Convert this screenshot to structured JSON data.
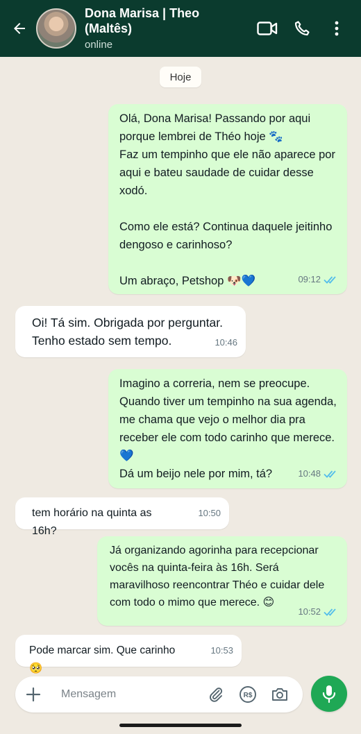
{
  "header": {
    "contact_name": "Dona Marisa | Theo (Maltês)",
    "status": "online",
    "background": "#0b3b2e"
  },
  "chat": {
    "date_chip": "Hoje",
    "messages": [
      {
        "direction": "out",
        "text": "Olá, Dona Marisa! Passando por aqui porque lembrei de Théo hoje 🐾\nFaz um tempinho que ele não aparece por aqui e bateu saudade de cuidar desse xodó.\n\nComo ele está? Continua daquele jeitinho dengoso e carinhoso?\n\nUm abraço, Petshop 🐶💙",
        "time": "09:12",
        "read": true
      },
      {
        "direction": "in",
        "text": "Oi! Tá sim. Obrigada por perguntar.\nTenho estado sem tempo.",
        "time": "10:46"
      },
      {
        "direction": "out",
        "text": "Imagino a correria, nem se preocupe. Quando tiver um tempinho na sua agenda, me chama que vejo o melhor dia pra receber ele com todo carinho que merece. 💙\nDá um beijo nele por mim, tá?",
        "time": "10:48",
        "read": true
      },
      {
        "direction": "in",
        "text": "tem horário na quinta as 16h?",
        "time": "10:50"
      },
      {
        "direction": "out",
        "text": "Já organizando agorinha para recepcionar vocês na quinta-feira às 16h. Será maravilhoso reencontrar Théo e cuidar dele com todo o mimo que merece. 😊",
        "time": "10:52",
        "read": true
      },
      {
        "direction": "in",
        "text": "Pode marcar sim. Que carinho 🥺",
        "time": "10:53"
      }
    ]
  },
  "composer": {
    "placeholder": "Mensagem",
    "icons": [
      "plus-icon",
      "paperclip-icon",
      "currency-icon",
      "camera-icon",
      "microphone-icon"
    ],
    "accent": "#1fa855"
  },
  "colors": {
    "outgoing_bubble": "#d9fdd3",
    "incoming_bubble": "#ffffff",
    "chat_background": "#efeae2",
    "read_ticks": "#53bdeb"
  }
}
